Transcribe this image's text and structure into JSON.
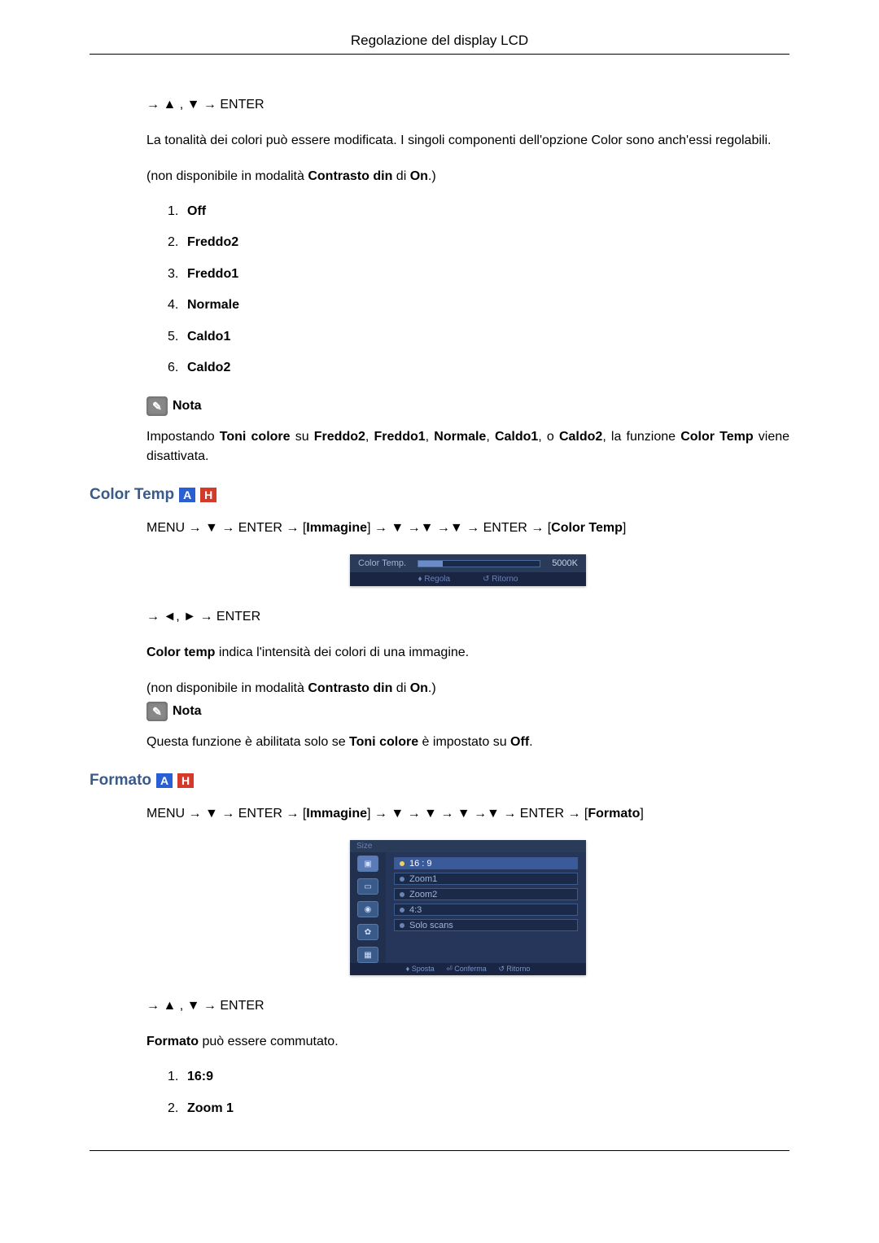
{
  "header": {
    "title": "Regolazione del display LCD"
  },
  "sec1": {
    "nav1": "→ ▲ , ▼ → ENTER",
    "para1": "La tonalità dei colori può essere modificata. I singoli componenti dell'opzione Color sono anch'essi regolabili.",
    "para2_pre": "(non disponibile in modalità ",
    "para2_bold": "Contrasto din",
    "para2_mid": " di ",
    "para2_bold2": "On",
    "para2_post": ".)",
    "items": [
      "Off",
      "Freddo2",
      "Freddo1",
      "Normale",
      "Caldo1",
      "Caldo2"
    ],
    "note_label": "Nota",
    "note_pre": "Impostando ",
    "note_b1": "Toni colore",
    "note_mid1": " su ",
    "note_b2": "Freddo2",
    "note_c": ", ",
    "note_b3": "Freddo1",
    "note_b4": "Normale",
    "note_b5": "Caldo1",
    "note_mid2": ", o ",
    "note_b6": "Caldo2",
    "note_mid3": ", la funzione ",
    "note_b7": "Color Temp",
    "note_post": " viene disattivata."
  },
  "sec2": {
    "title": "Color Temp",
    "badgeA": "A",
    "badgeH": "H",
    "nav1_pre": "MENU → ▼ → ENTER → [",
    "nav1_b1": "Immagine",
    "nav1_mid": "] → ▼ →▼ →▼ → ENTER → [",
    "nav1_b2": "Color Temp",
    "nav1_post": "]",
    "osd_label": "Color Temp.",
    "osd_value": "5000K",
    "osd_ctl1": "♦ Regola",
    "osd_ctl2": "↺ Ritorno",
    "nav2": "→ ◄, ► → ENTER",
    "para1_b": "Color temp",
    "para1_rest": " indica l'intensità dei colori di una immagine.",
    "para2_pre": "(non disponibile in modalità ",
    "para2_bold": "Contrasto din",
    "para2_mid": " di ",
    "para2_bold2": "On",
    "para2_post": ".)",
    "note_label": "Nota",
    "note2_pre": "Questa funzione è abilitata solo se ",
    "note2_b": "Toni colore",
    "note2_mid": " è impostato su ",
    "note2_b2": "Off",
    "note2_post": "."
  },
  "sec3": {
    "title": "Formato",
    "badgeA": "A",
    "badgeH": "H",
    "nav1_pre": "MENU → ▼ → ENTER → [",
    "nav1_b1": "Immagine",
    "nav1_mid": "] → ▼ → ▼ → ▼ →▼ → ENTER → [",
    "nav1_b2": "Formato",
    "nav1_post": "]",
    "osd_title": "Size",
    "osd_items": [
      "16 : 9",
      "Zoom1",
      "Zoom2",
      "4:3",
      "Solo scans"
    ],
    "osd_footer": {
      "a": "♦ Sposta",
      "b": "⏎ Conferma",
      "c": "↺ Ritorno"
    },
    "nav2": "→ ▲ , ▼ → ENTER",
    "para1_b": "Formato",
    "para1_rest": " può essere commutato.",
    "items": [
      "16:9",
      "Zoom 1"
    ]
  }
}
